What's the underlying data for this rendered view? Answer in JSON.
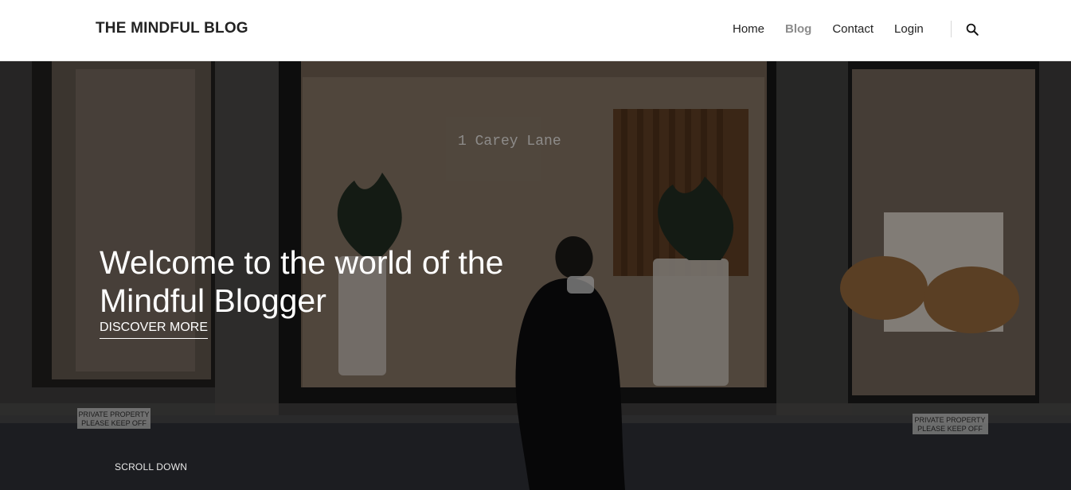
{
  "header": {
    "brand": "THE MINDFUL BLOG",
    "nav": [
      {
        "label": "Home",
        "active": false
      },
      {
        "label": "Blog",
        "active": true
      },
      {
        "label": "Contact",
        "active": false
      },
      {
        "label": "Login",
        "active": false
      }
    ],
    "search_icon": "search-icon"
  },
  "hero": {
    "title_line1": "Welcome to the world of the",
    "title_line2": "Mindful Blogger",
    "cta": "DISCOVER MORE",
    "scroll": "SCROLL DOWN",
    "sign_text": "1 Carey Lane",
    "placard_left_1": "PRIVATE PROPERTY",
    "placard_left_2": "PLEASE KEEP OFF",
    "placard_right_1": "PRIVATE PROPERTY",
    "placard_right_2": "PLEASE KEEP OFF"
  },
  "colors": {
    "nav_active": "#8c8c8c",
    "text": "#222222",
    "overlay": "#000000"
  }
}
